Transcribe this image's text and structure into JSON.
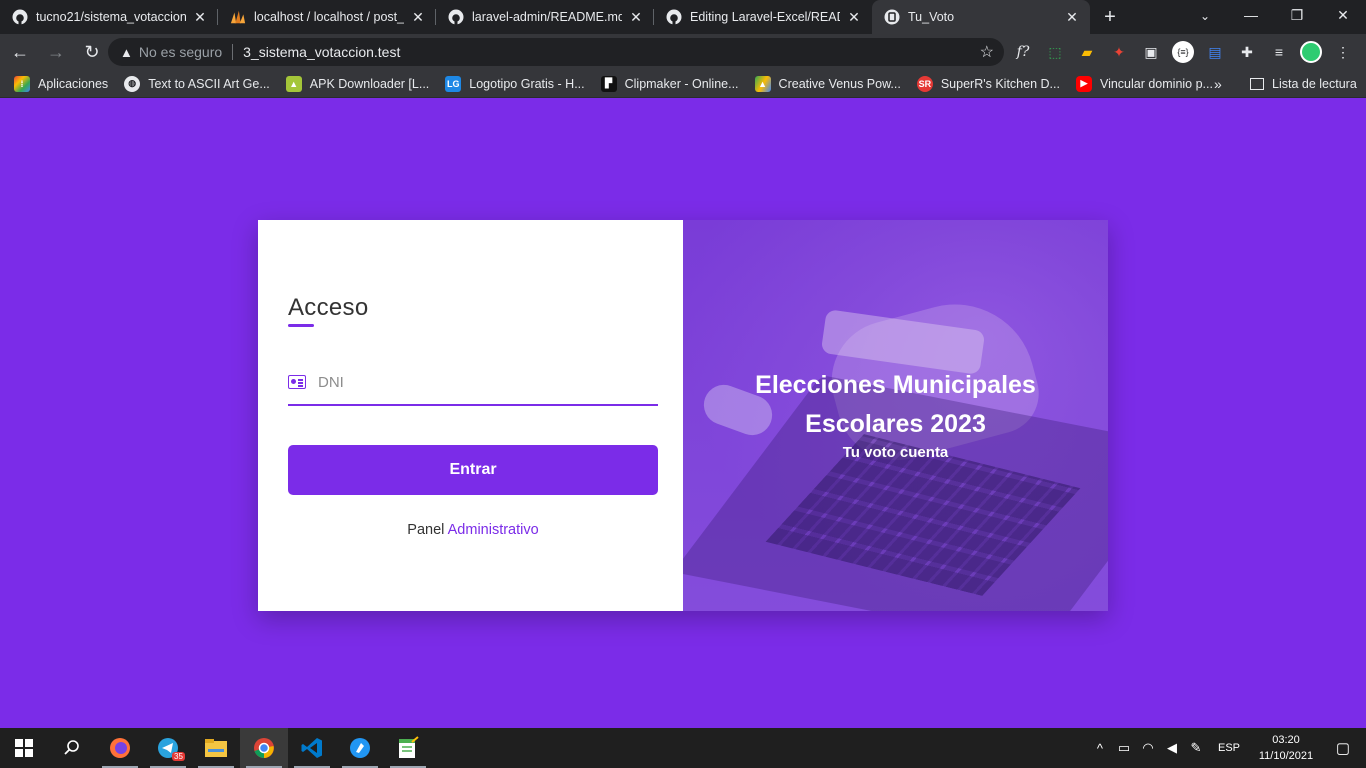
{
  "browser": {
    "tabs": [
      {
        "title": "tucno21/sistema_votaccion",
        "icon": "github-icon",
        "active": false
      },
      {
        "title": "localhost / localhost / post_v",
        "icon": "phpmyadmin-icon",
        "active": false
      },
      {
        "title": "laravel-admin/README.md a",
        "icon": "github-icon",
        "active": false
      },
      {
        "title": "Editing Laravel-Excel/READM",
        "icon": "github-icon",
        "active": false
      },
      {
        "title": "Tu_Voto",
        "icon": "site-icon",
        "active": true
      }
    ],
    "new_tab_label": "+",
    "security_label": "No es seguro",
    "url": "3_sistema_votaccion.test"
  },
  "bookmarks": [
    {
      "label": "Aplicaciones",
      "icon": "apps-grid-icon",
      "color": "#ea4335"
    },
    {
      "label": "Text to ASCII Art Ge...",
      "icon": "globe-icon",
      "color": "#5f6368"
    },
    {
      "label": "APK Downloader [L...",
      "icon": "apk-icon",
      "color": "#a4c639"
    },
    {
      "label": "Logotipo Gratis - H...",
      "icon": "logo-icon",
      "color": "#1e88e5"
    },
    {
      "label": "Clipmaker - Online...",
      "icon": "clipmaker-icon",
      "color": "#111111"
    },
    {
      "label": "Creative Venus Pow...",
      "icon": "drive-icon",
      "color": "#fbbc04"
    },
    {
      "label": "SuperR's Kitchen D...",
      "icon": "sr-icon",
      "color": "#e53935"
    },
    {
      "label": "Vincular dominio p...",
      "icon": "youtube-icon",
      "color": "#ff0000"
    }
  ],
  "bookmarks_more": "»",
  "reading_list": "Lista de lectura",
  "login": {
    "heading": "Acceso",
    "dni_placeholder": "DNI",
    "dni_value": "",
    "submit_label": "Entrar",
    "panel_prefix": "Panel",
    "panel_link": "Administrativo"
  },
  "hero": {
    "title_line1": "Elecciones Municipales",
    "title_line2": "Escolares 2023",
    "subtitle": "Tu voto cuenta"
  },
  "colors": {
    "accent": "#7b2ce8",
    "page_background": "#7b2ce8",
    "browser_dark": "#202124",
    "toolbar": "#35363a"
  },
  "taskbar": {
    "apps": [
      "windows-start-icon",
      "search-icon",
      "firefox-icon",
      "telegram-icon",
      "file-explorer-icon",
      "chrome-icon",
      "vscode-icon",
      "postman-icon",
      "notepad-icon"
    ],
    "telegram_badge": "35",
    "language": "ESP",
    "time": "03:20",
    "date": "11/10/2021"
  }
}
